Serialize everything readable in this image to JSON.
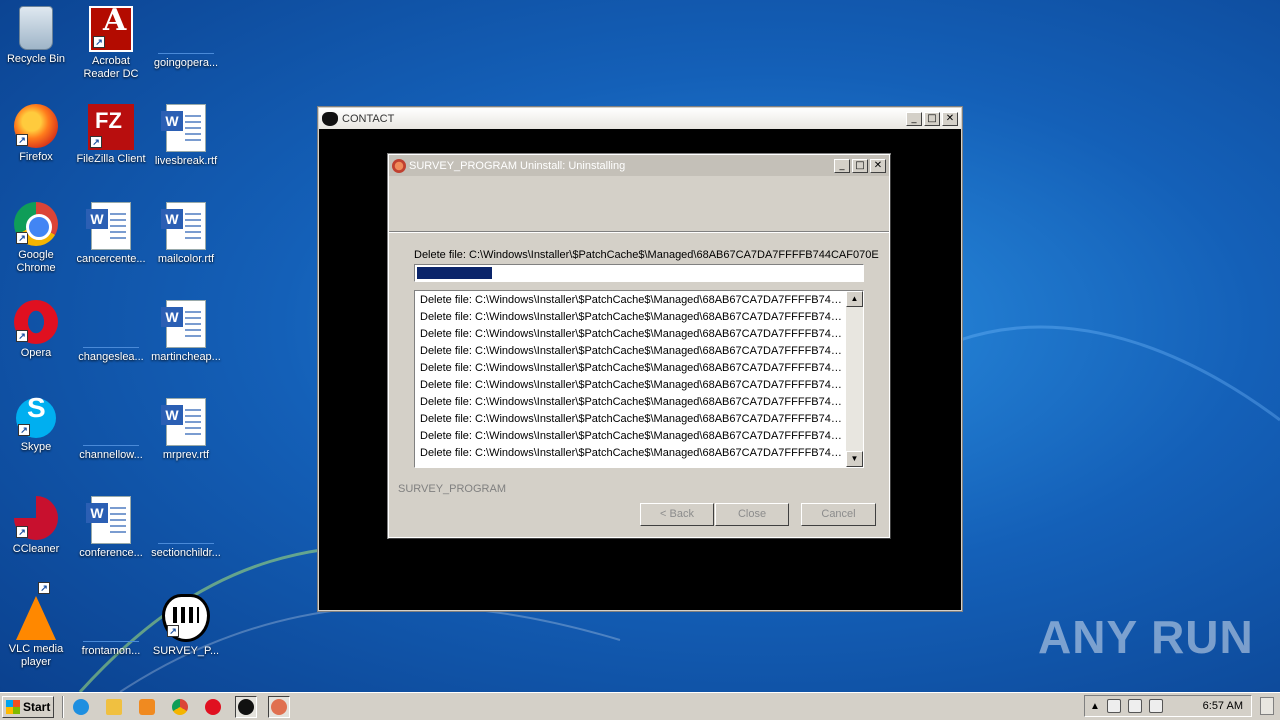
{
  "desktop": {
    "icons": [
      {
        "label": "Recycle Bin",
        "icon": "recycle-bin-icon"
      },
      {
        "label": "Acrobat Reader DC",
        "icon": "acrobat-icon"
      },
      {
        "label": "goingopera...",
        "icon": "blank-file-icon"
      },
      {
        "label": "Firefox",
        "icon": "firefox-icon"
      },
      {
        "label": "FileZilla Client",
        "icon": "filezilla-icon"
      },
      {
        "label": "livesbreak.rtf",
        "icon": "word-doc-icon"
      },
      {
        "label": "Google Chrome",
        "icon": "chrome-icon"
      },
      {
        "label": "cancercente...",
        "icon": "word-doc-icon"
      },
      {
        "label": "mailcolor.rtf",
        "icon": "word-doc-icon"
      },
      {
        "label": "Opera",
        "icon": "opera-icon"
      },
      {
        "label": "changeslea...",
        "icon": "blank-file-icon"
      },
      {
        "label": "martincheap...",
        "icon": "word-doc-icon"
      },
      {
        "label": "Skype",
        "icon": "skype-icon"
      },
      {
        "label": "channellow...",
        "icon": "blank-file-icon"
      },
      {
        "label": "mrprev.rtf",
        "icon": "word-doc-icon"
      },
      {
        "label": "CCleaner",
        "icon": "ccleaner-icon"
      },
      {
        "label": "conference...",
        "icon": "word-doc-icon"
      },
      {
        "label": "sectionchildr...",
        "icon": "blank-file-icon"
      },
      {
        "label": "VLC media player",
        "icon": "vlc-icon"
      },
      {
        "label": "frontamon...",
        "icon": "blank-file-icon"
      },
      {
        "label": "SURVEY_P...",
        "icon": "survey-heart-icon"
      }
    ]
  },
  "outer_window": {
    "title": "CONTACT",
    "min": "_",
    "max": "□",
    "close": "✕"
  },
  "installer": {
    "title": "SURVEY_PROGRAM Uninstall: Uninstalling",
    "status": "Delete file: C:\\Windows\\Installer\\$PatchCache$\\Managed\\68AB67CA7DA7FFFFB744CAF070E",
    "progress": 0.17,
    "log": [
      "Delete file: C:\\Windows\\Installer\\$PatchCache$\\Managed\\68AB67CA7DA7FFFFB744...",
      "Delete file: C:\\Windows\\Installer\\$PatchCache$\\Managed\\68AB67CA7DA7FFFFB744...",
      "Delete file: C:\\Windows\\Installer\\$PatchCache$\\Managed\\68AB67CA7DA7FFFFB744...",
      "Delete file: C:\\Windows\\Installer\\$PatchCache$\\Managed\\68AB67CA7DA7FFFFB744...",
      "Delete file: C:\\Windows\\Installer\\$PatchCache$\\Managed\\68AB67CA7DA7FFFFB744...",
      "Delete file: C:\\Windows\\Installer\\$PatchCache$\\Managed\\68AB67CA7DA7FFFFB744...",
      "Delete file: C:\\Windows\\Installer\\$PatchCache$\\Managed\\68AB67CA7DA7FFFFB744...",
      "Delete file: C:\\Windows\\Installer\\$PatchCache$\\Managed\\68AB67CA7DA7FFFFB744...",
      "Delete file: C:\\Windows\\Installer\\$PatchCache$\\Managed\\68AB67CA7DA7FFFFB744...",
      "Delete file: C:\\Windows\\Installer\\$PatchCache$\\Managed\\68AB67CA7DA7FFFFB744..."
    ],
    "brand": "SURVEY_PROGRAM",
    "back_label": "< Back",
    "close_label": "Close",
    "cancel_label": "Cancel"
  },
  "watermark": "ANY RUN",
  "taskbar": {
    "start_label": "Start",
    "clock": "6:57 AM",
    "pinned": [
      "ie-icon",
      "explorer-icon",
      "media-player-icon",
      "chrome-icon",
      "opera-icon",
      "survey-heart-icon",
      "installer-icon"
    ]
  },
  "colors": {
    "desktop_blue": "#1460b8",
    "progress_fill": "#0a246a",
    "dialog_face": "#d4d0c8"
  }
}
